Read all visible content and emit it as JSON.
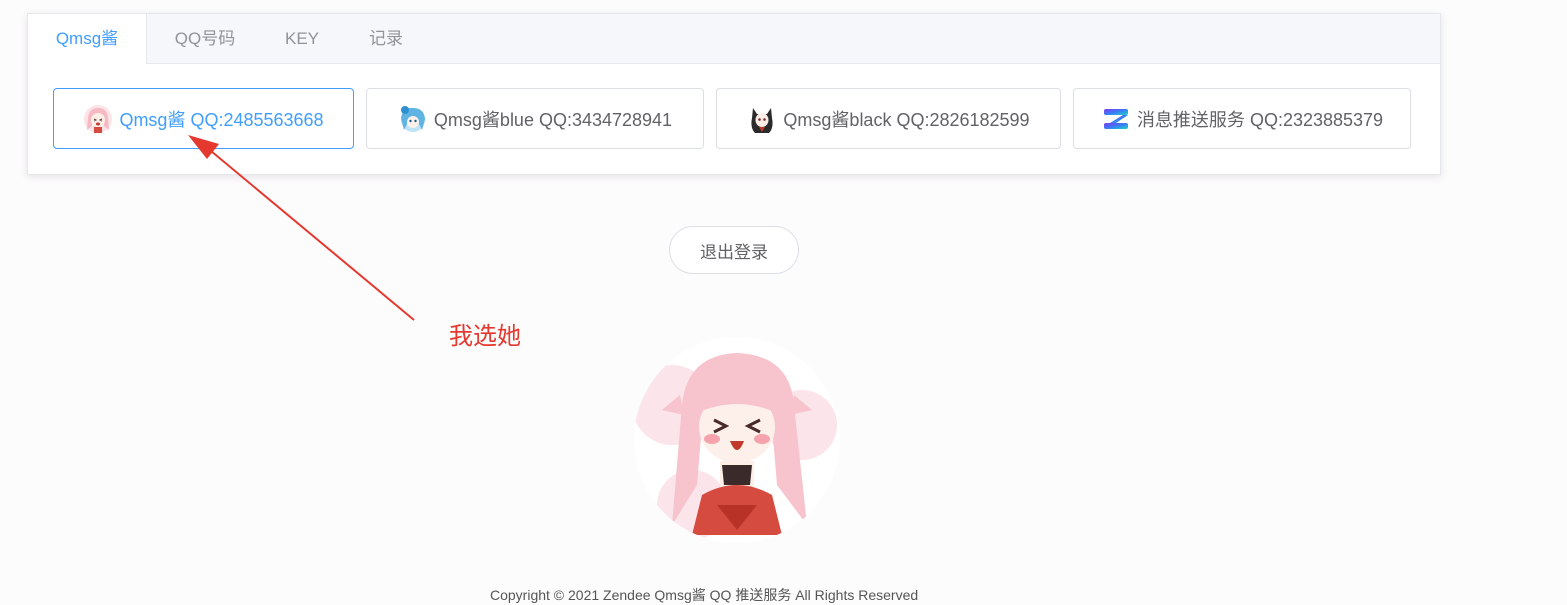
{
  "tabs": [
    {
      "label": "Qmsg酱",
      "active": true
    },
    {
      "label": "QQ号码",
      "active": false
    },
    {
      "label": "KEY",
      "active": false
    },
    {
      "label": "记录",
      "active": false
    }
  ],
  "bots": [
    {
      "label": "Qmsg酱 QQ:2485563668",
      "icon": "pink-girl-avatar-icon",
      "selected": true
    },
    {
      "label": "Qmsg酱blue QQ:3434728941",
      "icon": "blue-girl-avatar-icon",
      "selected": false
    },
    {
      "label": "Qmsg酱black QQ:2826182599",
      "icon": "black-girl-avatar-icon",
      "selected": false
    },
    {
      "label": "消息推送服务 QQ:2323885379",
      "icon": "z-logo-icon",
      "selected": false
    }
  ],
  "logout_label": "退出登录",
  "annotation_text": "我选她",
  "footer_text": "Copyright © 2021 Zendee Qmsg酱 QQ 推送服务 All Rights Reserved",
  "colors": {
    "accent": "#409eff",
    "annotation": "#e5382f",
    "border": "#dcdfe6"
  }
}
